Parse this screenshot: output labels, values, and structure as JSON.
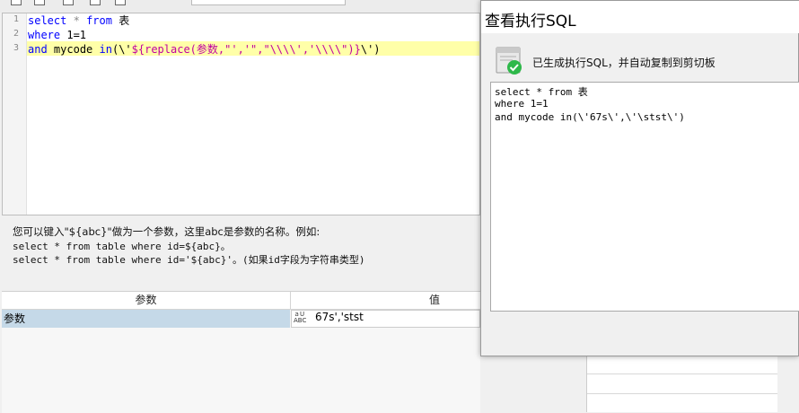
{
  "editor": {
    "line_numbers": [
      "1",
      "2",
      "3"
    ],
    "line1": {
      "kw1": "select",
      "star": "*",
      "kw2": "from",
      "table": "表"
    },
    "line2": {
      "kw": "where",
      "cond": "1=1"
    },
    "line3": {
      "kw": "and",
      "ident": "mycode",
      "kw2": "in",
      "open": "(\\'",
      "expr": "${replace(参数,\"','\",\"\\\\\\\\','\\\\\\\\\")}",
      "close": "\\')"
    }
  },
  "help": {
    "line1": "您可以键入\"${abc}\"做为一个参数，这里abc是参数的名称。例如:",
    "line2": "select * from table where id=${abc}。",
    "line3": "select * from table where id='${abc}'。(如果id字段为字符串类型)"
  },
  "grid": {
    "col_name": "参数",
    "col_value": "值",
    "row": {
      "name": "参数",
      "type_icon_top": "ａU",
      "type_icon_bottom": "ABC",
      "value": "67s','stst"
    }
  },
  "dialog": {
    "title": "查看执行SQL",
    "message": "已生成执行SQL，并自动复制到剪切板",
    "output": [
      "select * from 表",
      "where 1=1",
      "and mycode in(\\'67s\\',\\'\\stst\\')"
    ]
  },
  "colors": {
    "keyword": "#0000ff",
    "string": "#c000a0",
    "line_highlight": "#ffffa8",
    "row_selected": "#c5d9e8",
    "success_green": "#2eb84a"
  }
}
